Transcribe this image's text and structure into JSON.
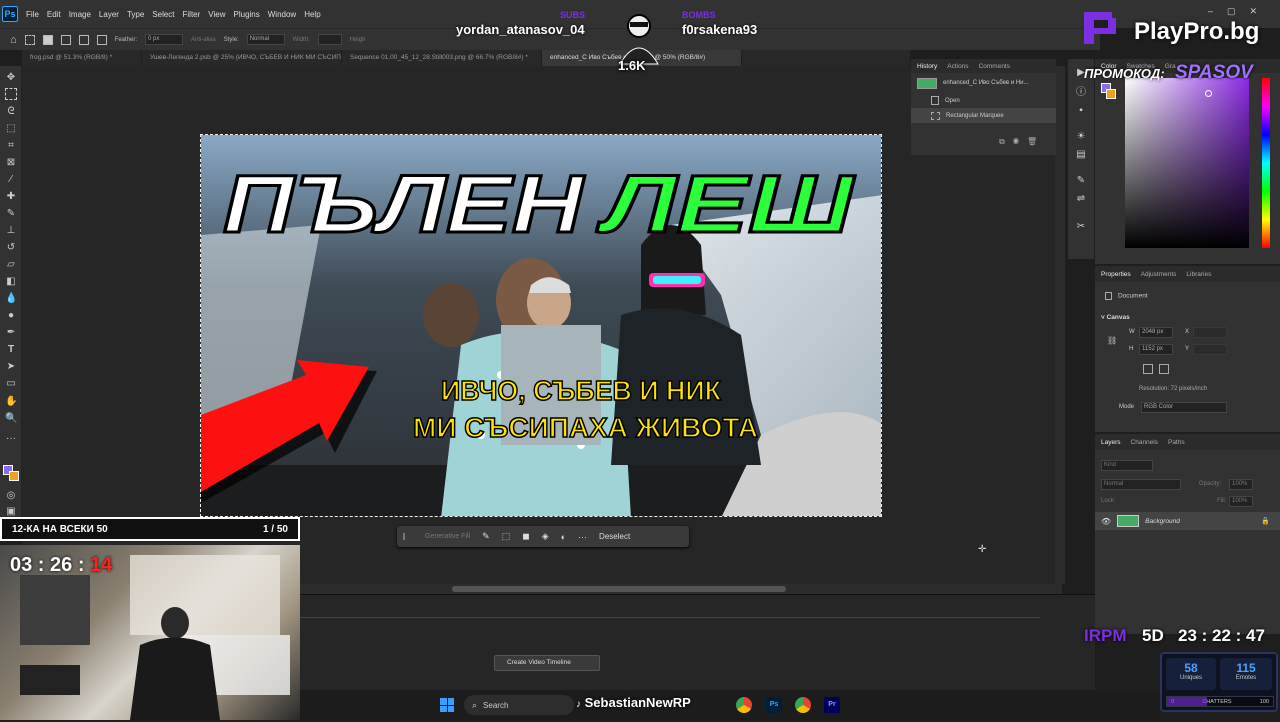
{
  "menubar": {
    "items": [
      "File",
      "Edit",
      "Image",
      "Layer",
      "Type",
      "Select",
      "Filter",
      "View",
      "Plugins",
      "Window",
      "Help"
    ]
  },
  "options": {
    "feather_label": "Feather:",
    "feather_value": "0 px",
    "antialias_label": "Anti-alias",
    "style_label": "Style:",
    "style_value": "Normal",
    "width_label": "Width:",
    "height_label": "Heigh",
    "select_mask": "Select and Mask..."
  },
  "tabs": [
    {
      "label": "frog.psd @ 51.3% (RGB/8) *"
    },
    {
      "label": "Ушев-Легенда 2.psb @ 25% (ИВЧО, СЪБЕВ И НИК  МИ СЪСИПАХА ЖИВОТА, RGB/8) *"
    },
    {
      "label": "Sequence 01.00_45_12_28.Still003.png @ 66.7% (RGB/8#) *"
    },
    {
      "label": "enhanced_С Иво Събев и Ник.png @ 50% (RGB/8#)"
    }
  ],
  "thumbnail": {
    "title_white": "ПЪЛЕН",
    "title_green": "ЛЕШ",
    "subtitle_line1": "ИВЧО, СЪБЕВ И НИК",
    "subtitle_line2": "МИ СЪСИПАХА ЖИВОТА"
  },
  "context_bar": {
    "generative_fill": "Generative Fill",
    "deselect": "Deselect"
  },
  "history": {
    "tabs": [
      "History",
      "Actions",
      "Comments"
    ],
    "snapshot": "enhanced_С Иво Събев и Ни...",
    "items": [
      "Open",
      "Rectangular Marquee"
    ]
  },
  "color_panel": {
    "tabs": [
      "Color",
      "Swatches",
      "Gra"
    ]
  },
  "properties": {
    "tabs": [
      "Properties",
      "Adjustments",
      "Libraries"
    ],
    "document": "Document",
    "canvas_label": "Canvas",
    "w_label": "W",
    "w_value": "2048 px",
    "h_label": "H",
    "h_value": "1152 px",
    "x_label": "X",
    "y_label": "Y",
    "resolution": "Resolution: 72 pixels/inch",
    "mode_label": "Mode",
    "mode_value": "RGB Color"
  },
  "layers": {
    "tabs": [
      "Layers",
      "Channels",
      "Paths"
    ],
    "kind": "Kind",
    "blend": "Normal",
    "opacity_label": "Opacity:",
    "opacity_value": "100%",
    "lock_label": "Lock:",
    "fill_label": "Fill:",
    "fill_value": "100%",
    "layer_name": "Background"
  },
  "timeline": {
    "button": "Create Video Timeline"
  },
  "overlay": {
    "sub_label_left": "SUBS",
    "user_left": "yordan_atanasov_04",
    "sub_label_right": "BOMBS",
    "user_right": "f0rsakena93",
    "badge_count": "1.6K",
    "brand": "PlayPro.bg",
    "promo_label": "ПРОМОКОД:",
    "promo_code": "SPASOV",
    "goal_label": "12-КА НА ВСЕКИ 50",
    "goal_count": "1 / 50",
    "timer_hm": "03 : 26 :",
    "timer_s": "14",
    "irpm": "IRPM",
    "days": "5D",
    "clock": "23 : 22 : 47",
    "uniques_value": "58",
    "uniques_label": "Uniques",
    "emotes_value": "115",
    "emotes_label": "Emotes",
    "chatters_min": "0",
    "chatters_label": "CHATTERS",
    "chatters_max": "100",
    "watermark": "SebastianNewRP"
  },
  "taskbar": {
    "search": "Search"
  },
  "colors": {
    "accent_green": "#2bff3a",
    "accent_yellow": "#ffe400",
    "accent_purple": "#7b2fe0",
    "arrow_red": "#ff1010"
  }
}
